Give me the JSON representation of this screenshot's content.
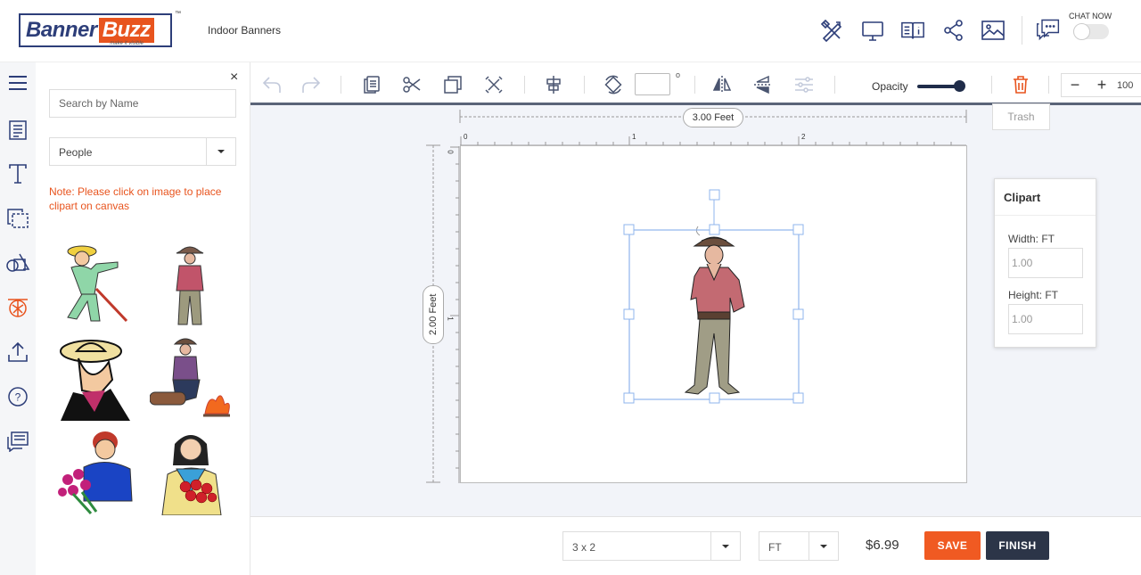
{
  "header": {
    "logo_part1": "Banner",
    "logo_part2": "Buzz",
    "logo_tagline": "make it visible",
    "logo_tm": "™",
    "product_name": "Indoor Banners",
    "chat_now": "CHAT NOW",
    "icons": [
      "design-tools-icon",
      "preview-monitor-icon",
      "book-info-icon",
      "share-icon",
      "image-icon",
      "chat-icon"
    ]
  },
  "sidebar_rail": {
    "icons": [
      "menu-icon",
      "template-icon",
      "text-icon",
      "background-icon",
      "shapes-icon",
      "clipart-icon",
      "upload-icon",
      "help-icon",
      "comments-icon"
    ],
    "active": "clipart-icon",
    "active_color": "#e8541e"
  },
  "clipart_panel": {
    "close": "×",
    "search_placeholder": "Search by Name",
    "category": "People",
    "note": "Note: Please click on image to place clipart on canvas",
    "items": [
      "elderly-man-walking",
      "cowboy-smoking",
      "cowboy-tipping-hat",
      "cowboy-campfire",
      "woman-with-flowers",
      "woman-with-roses"
    ]
  },
  "toolbar": {
    "rotation_value": "",
    "degree_symbol": "o",
    "opacity_label": "Opacity",
    "opacity_value": 1.0,
    "trash_tooltip": "Trash",
    "zoom_minus": "−",
    "zoom_plus": "+",
    "zoom_value": "100"
  },
  "canvas": {
    "width_label": "3.00 Feet",
    "height_label": "2.00 Feet",
    "ruler_top": [
      "0",
      "1",
      "2"
    ],
    "ruler_left": [
      "0",
      "1"
    ]
  },
  "clipart_props": {
    "title": "Clipart",
    "width_label": "Width: FT",
    "width_value": "1.00",
    "height_label": "Height: FT",
    "height_value": "1.00"
  },
  "footer": {
    "size": "3 x 2",
    "unit": "FT",
    "price": "$6.99",
    "save": "SAVE",
    "finish": "FINISH",
    "save_color": "#f05a22",
    "finish_color": "#2c3548"
  }
}
